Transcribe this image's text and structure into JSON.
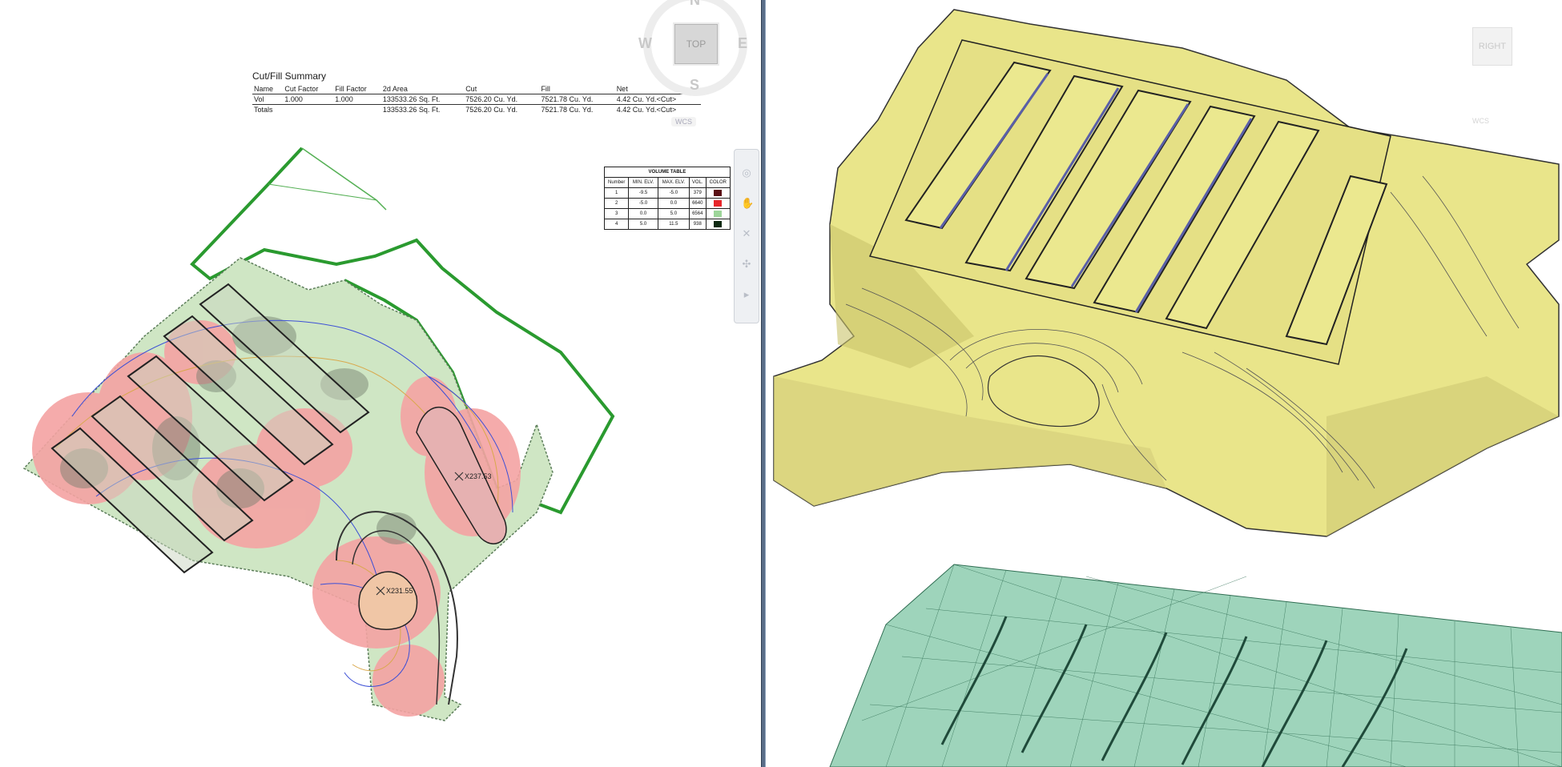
{
  "cut_fill_summary": {
    "title": "Cut/Fill Summary",
    "headers": [
      "Name",
      "Cut Factor",
      "Fill Factor",
      "2d Area",
      "Cut",
      "Fill",
      "Net"
    ],
    "rows": [
      [
        "Vol",
        "1.000",
        "1.000",
        "133533.26 Sq. Ft.",
        "7526.20 Cu. Yd.",
        "7521.78 Cu. Yd.",
        "4.42 Cu. Yd.<Cut>"
      ],
      [
        "Totals",
        "",
        "",
        "133533.26 Sq. Ft.",
        "7526.20 Cu. Yd.",
        "7521.78 Cu. Yd.",
        "4.42 Cu. Yd.<Cut>"
      ]
    ]
  },
  "volume_table": {
    "title": "VOLUME TABLE",
    "headers": [
      "Number",
      "MIN. ELV.",
      "MAX. ELV.",
      "VOL.",
      "COLOR"
    ],
    "rows": [
      {
        "number": "1",
        "min": "-9.5",
        "max": "-5.0",
        "vol": "379",
        "color": "#5a0f14"
      },
      {
        "number": "2",
        "min": "-5.0",
        "max": "0.0",
        "vol": "6640",
        "color": "#e8262b"
      },
      {
        "number": "3",
        "min": "0.0",
        "max": "5.0",
        "vol": "6564",
        "color": "#9ed69a"
      },
      {
        "number": "4",
        "min": "5.0",
        "max": "11.5",
        "vol": "938",
        "color": "#0f2a12"
      }
    ]
  },
  "viewcube_left": {
    "n": "N",
    "s": "S",
    "e": "E",
    "w": "W",
    "face": "TOP",
    "wcs": "WCS"
  },
  "viewcube_right": {
    "face": "RIGHT",
    "wcs": "WCS"
  },
  "spot_labels": [
    "X237.53",
    "X231.55"
  ],
  "colors": {
    "cut_red": "#f4a3a3",
    "fill_green": "#cfe6c4",
    "boundary": "#2a9a2f",
    "surface_yellow": "#e9e58a",
    "mesh_green": "#9ed4bb",
    "splitter": "#5a6e88"
  }
}
